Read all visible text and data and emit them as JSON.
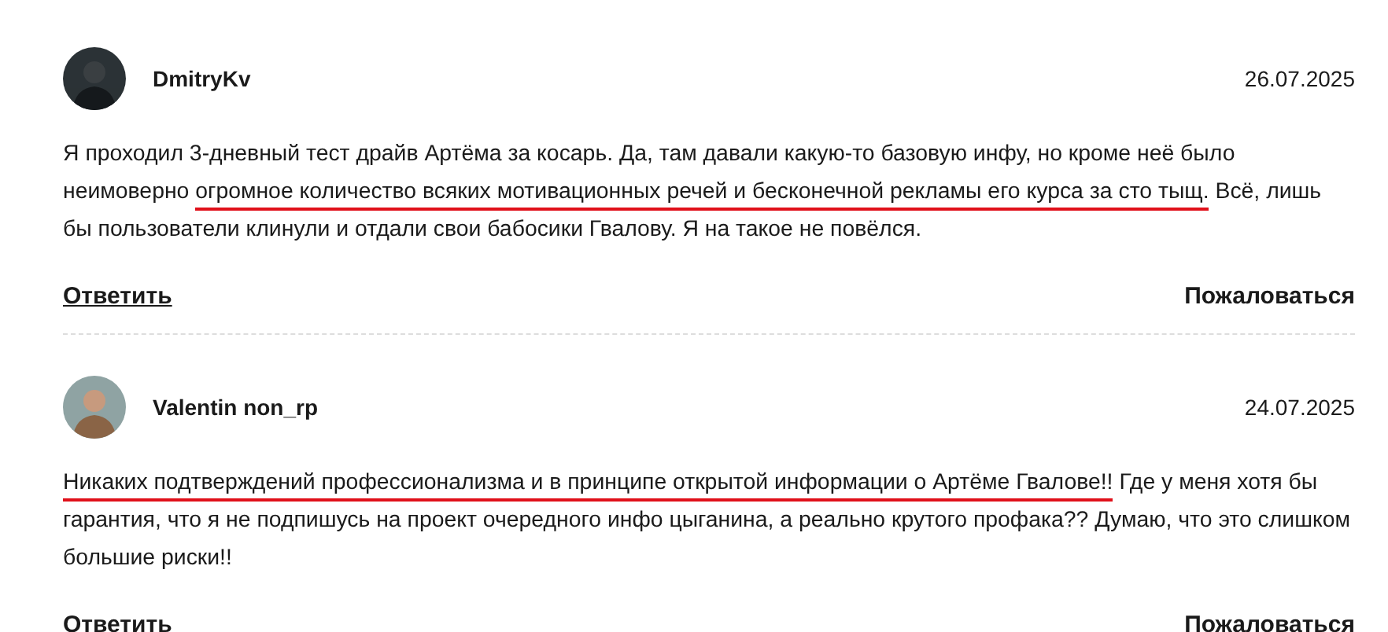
{
  "comments": [
    {
      "author": "DmitryKv",
      "avatar": {
        "kind": "picture"
      },
      "date": "26.07.2025",
      "text": [
        {
          "text": "Я проходил 3-дневный тест драйв Артёма за косарь. Да, там давали какую-то базовую инфу, но кроме неё было неимоверно ",
          "marked": false
        },
        {
          "text": "огромное количество всяких мотивационных речей и бесконечной рекламы его курса за сто тыщ.",
          "marked": true
        },
        {
          "text": " Всё, лишь бы пользователи клинули и отдали свои бабосики Гвалову. Я на такое не повёлся.",
          "marked": false
        }
      ],
      "reply": "Ответить",
      "report": "Пожаловаться"
    },
    {
      "author": "Valentin non_rp",
      "avatar": {
        "kind": "picture"
      },
      "date": "24.07.2025",
      "text": [
        {
          "text": "Никаких подтверждений профессионализма и в принципе открытой информации о Артёме Гвалове!!",
          "marked": true
        },
        {
          "text": " Где у меня хотя бы гарантия, что я не подпишусь на проект очередного инфо цыганина, а реально крутого профака?? Думаю, что это слишком большие риски!!",
          "marked": false
        }
      ],
      "reply": "Ответить",
      "report": "Пожаловаться"
    }
  ]
}
